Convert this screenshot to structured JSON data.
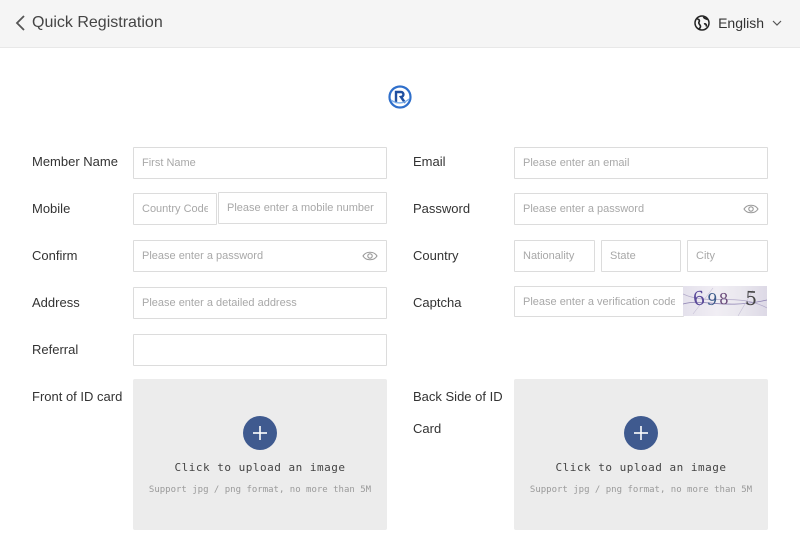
{
  "header": {
    "back_label": "Quick Registration",
    "language": "English"
  },
  "form": {
    "labels": {
      "member_name": "Member Name",
      "email": "Email",
      "mobile": "Mobile",
      "password": "Password",
      "confirm": "Confirm",
      "country": "Country",
      "address": "Address",
      "captcha": "Captcha",
      "referral": "Referral",
      "front_id": "Front of ID card",
      "back_id_line1": "Back Side of ID",
      "back_id_line2": "Card"
    },
    "placeholders": {
      "first_name": "First Name",
      "email": "Please enter an email",
      "country_code": "Country Code",
      "mobile": "Please enter a mobile number",
      "password": "Please enter a password",
      "confirm": "Please enter a password",
      "nationality": "Nationality",
      "state": "State",
      "city": "City",
      "address": "Please enter a detailed address",
      "captcha": "Please enter a verification code",
      "referral": ""
    },
    "captcha_code": [
      "6",
      "9",
      "8",
      "5"
    ],
    "upload": {
      "text": "Click to upload an image",
      "hint": "Support jpg / png format, no more than 5M"
    }
  },
  "colors": {
    "upload_button": "#3f5a8f",
    "logo": "#2f6fcb",
    "field_border": "#dcdcdc",
    "placeholder": "#a8a8a8"
  },
  "icons": {
    "back": "chevron-left-icon",
    "language": "globe-icon",
    "dropdown": "chevron-down-icon",
    "password_toggle": "eye-icon",
    "upload": "plus-icon"
  }
}
